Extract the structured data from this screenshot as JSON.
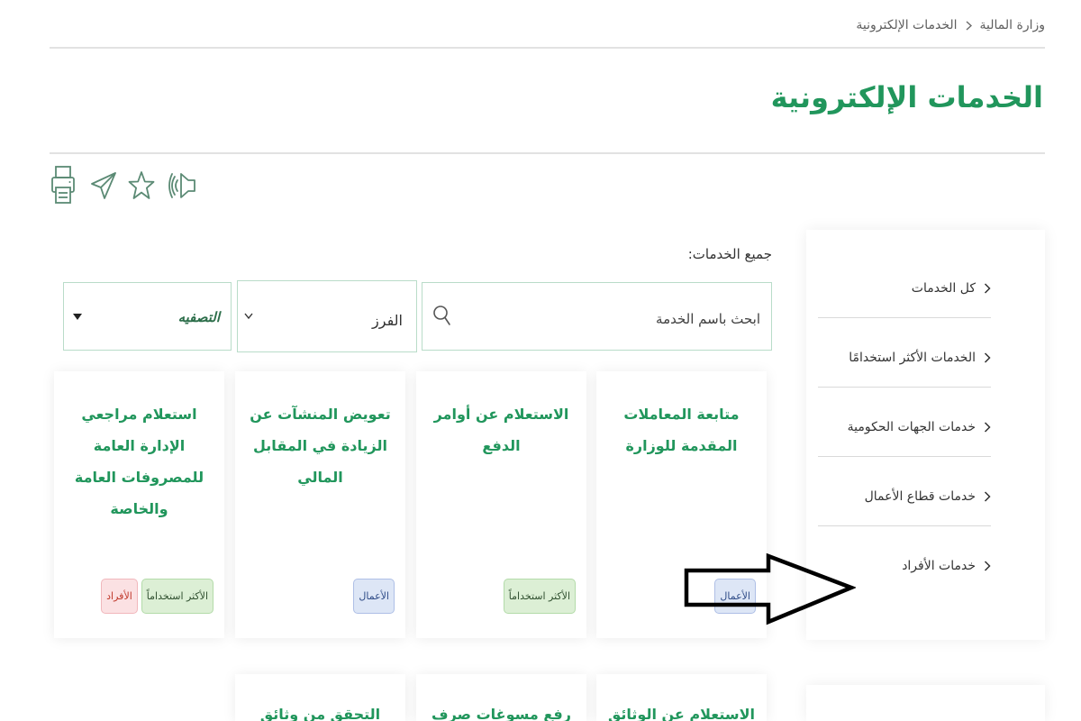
{
  "breadcrumb": {
    "home": "وزارة المالية",
    "current": "الخدمات الإلكترونية"
  },
  "page_title": "الخدمات الإلكترونية",
  "toolbar": {
    "icons": [
      "printer-icon",
      "send-icon",
      "star-icon",
      "speaker-icon"
    ]
  },
  "sidebar": {
    "items": [
      {
        "label": "كل الخدمات"
      },
      {
        "label": "الخدمات الأكثر استخدامًا"
      },
      {
        "label": "خدمات الجهات الحكومية"
      },
      {
        "label": "خدمات قطاع الأعمال"
      },
      {
        "label": "خدمات الأفراد"
      }
    ]
  },
  "services": {
    "heading": "جميع الخدمات:",
    "search": {
      "placeholder": "ابحث باسم الخدمة",
      "icon": "search-icon"
    },
    "sort": {
      "selected": "الفرز",
      "icon": "chevron-down-icon"
    },
    "filter": {
      "selected": "التصفيه",
      "icon": "caret-down-icon"
    },
    "cards": [
      {
        "title": "متابعة المعاملات المقدمة للوزارة",
        "badges": [
          "الأعمال"
        ]
      },
      {
        "title": "الاستعلام عن أوامر الدفع",
        "badges": [
          "الأكثر استخداماً"
        ]
      },
      {
        "title": "تعويض المنشآت عن الزيادة في المقابل المالي",
        "badges": [
          "الأعمال"
        ]
      },
      {
        "title": "استعلام مراجعي الإدارة العامة للمصروفات العامة والخاصة",
        "badges": [
          "الأكثر استخداماً",
          "الأفراد"
        ]
      },
      {
        "title": "الاستعلام عن الوثائق"
      },
      {
        "title": "رفع مسوغات صرف"
      },
      {
        "title": "التحقق من وثائق"
      }
    ]
  },
  "colors": {
    "primary": "#21965c",
    "primary_dark": "#2c6e4a",
    "text": "#333333",
    "muted": "#5e5e5e",
    "divider": "#e2e2e2",
    "field_border": "#b9dcc9",
    "icon": "#5b8a74",
    "badge_most_used_bg": "#dcefd5",
    "badge_most_used_border": "#b3dba9",
    "badge_most_used_text": "#2f4f2f",
    "badge_business_bg": "#dde6f6",
    "badge_business_border": "#aebfe6",
    "badge_business_text": "#2d4a86",
    "badge_individuals_bg": "#fbe1e3",
    "badge_individuals_border": "#f1b7bc",
    "badge_individuals_text": "#c0392b"
  }
}
